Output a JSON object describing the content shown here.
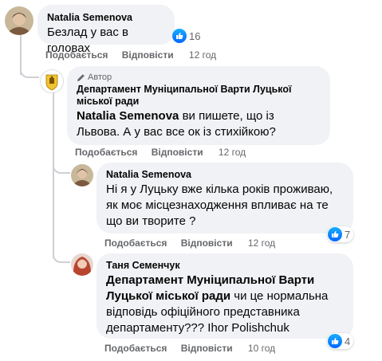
{
  "comments": [
    {
      "author": "Natalia Semenova",
      "text": "Безлад у вас в головах",
      "reactions": "16",
      "like_label": "Подобається",
      "reply_label": "Відповісти",
      "time": "12 год"
    },
    {
      "badge": "Автор",
      "author": "Департамент Муніципальної Варти Луцької міської ради",
      "mention": "Natalia Semenova",
      "text": " ви пишете, що із Львова. А у вас все ок із стихійкою?",
      "like_label": "Подобається",
      "reply_label": "Відповісти",
      "time": "12 год"
    },
    {
      "author": "Natalia Semenova",
      "text": "Ні я у Луцьку вже кілька років проживаю, як моє місцезнаходження впливає на те що ви творите ?",
      "reactions": "7",
      "like_label": "Подобається",
      "reply_label": "Відповісти",
      "time": "12 год"
    },
    {
      "author": "Таня Семенчук",
      "mention": "Департамент Муніципальної Варти Луцької міської ради",
      "text": " чи це нормальна відповідь офіційного представника департаменту??? Ihor Polishchuk",
      "reactions": "4",
      "like_label": "Подобається",
      "reply_label": "Відповісти",
      "time": "10 год"
    }
  ],
  "colors": {
    "bubble": "#f0f2f5",
    "meta": "#65676b",
    "like_blue": "#0566ff"
  }
}
